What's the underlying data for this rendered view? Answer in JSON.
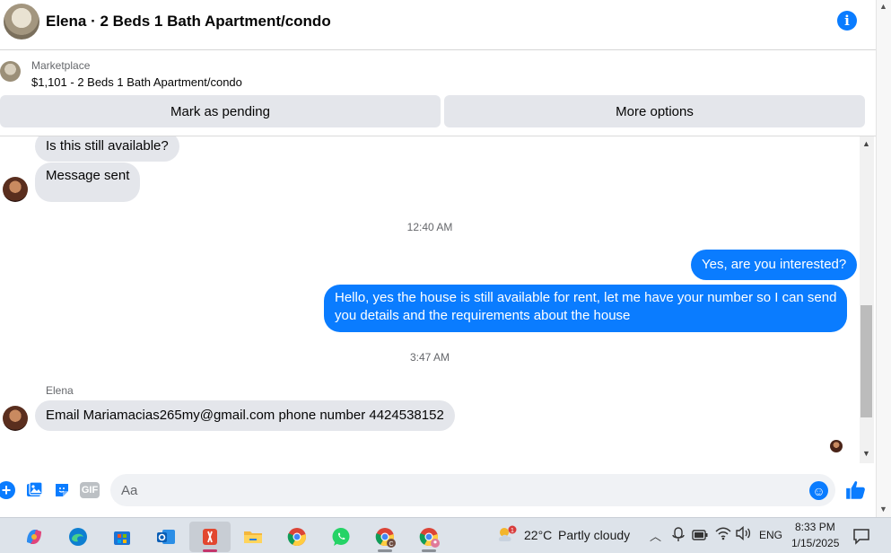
{
  "header": {
    "title": "Elena · 2 Beds 1 Bath Apartment/condo"
  },
  "listing": {
    "source_label": "Marketplace",
    "title": "$1,101 - 2 Beds 1 Bath Apartment/condo",
    "pending_button": "Mark as pending",
    "more_button": "More options"
  },
  "messages": [
    {
      "from": "in",
      "text": "Is this still available?"
    },
    {
      "from": "in",
      "text": "Message sent"
    },
    {
      "timestamp": "12:40 AM"
    },
    {
      "from": "out",
      "text": "Yes, are you interested?"
    },
    {
      "from": "out",
      "line1": "Hello, yes the house is still available for rent, let me have your number so I can send",
      "line2": "you details and the requirements about the house"
    },
    {
      "timestamp": "3:47 AM"
    },
    {
      "sender": "Elena",
      "from": "in",
      "text": "Email Mariamacias265my@gmail.com phone number 4424538152"
    }
  ],
  "composer": {
    "placeholder": "Aa",
    "gif_label": "GIF"
  },
  "taskbar": {
    "weather": {
      "temp": "22°C",
      "condition": "Partly cloudy",
      "alert_count": "1"
    },
    "language": "ENG",
    "time": "8:33 PM",
    "date": "1/15/2025",
    "apps": [
      "copilot",
      "edge",
      "microsoft-store",
      "outlook",
      "snipping-tool",
      "file-explorer",
      "chrome",
      "whatsapp",
      "chrome-profile-c",
      "chrome-profile-2"
    ]
  },
  "colors": {
    "accent": "#0a7cff",
    "bubble_in": "#e4e6eb",
    "taskbar": "#dde3ea"
  }
}
